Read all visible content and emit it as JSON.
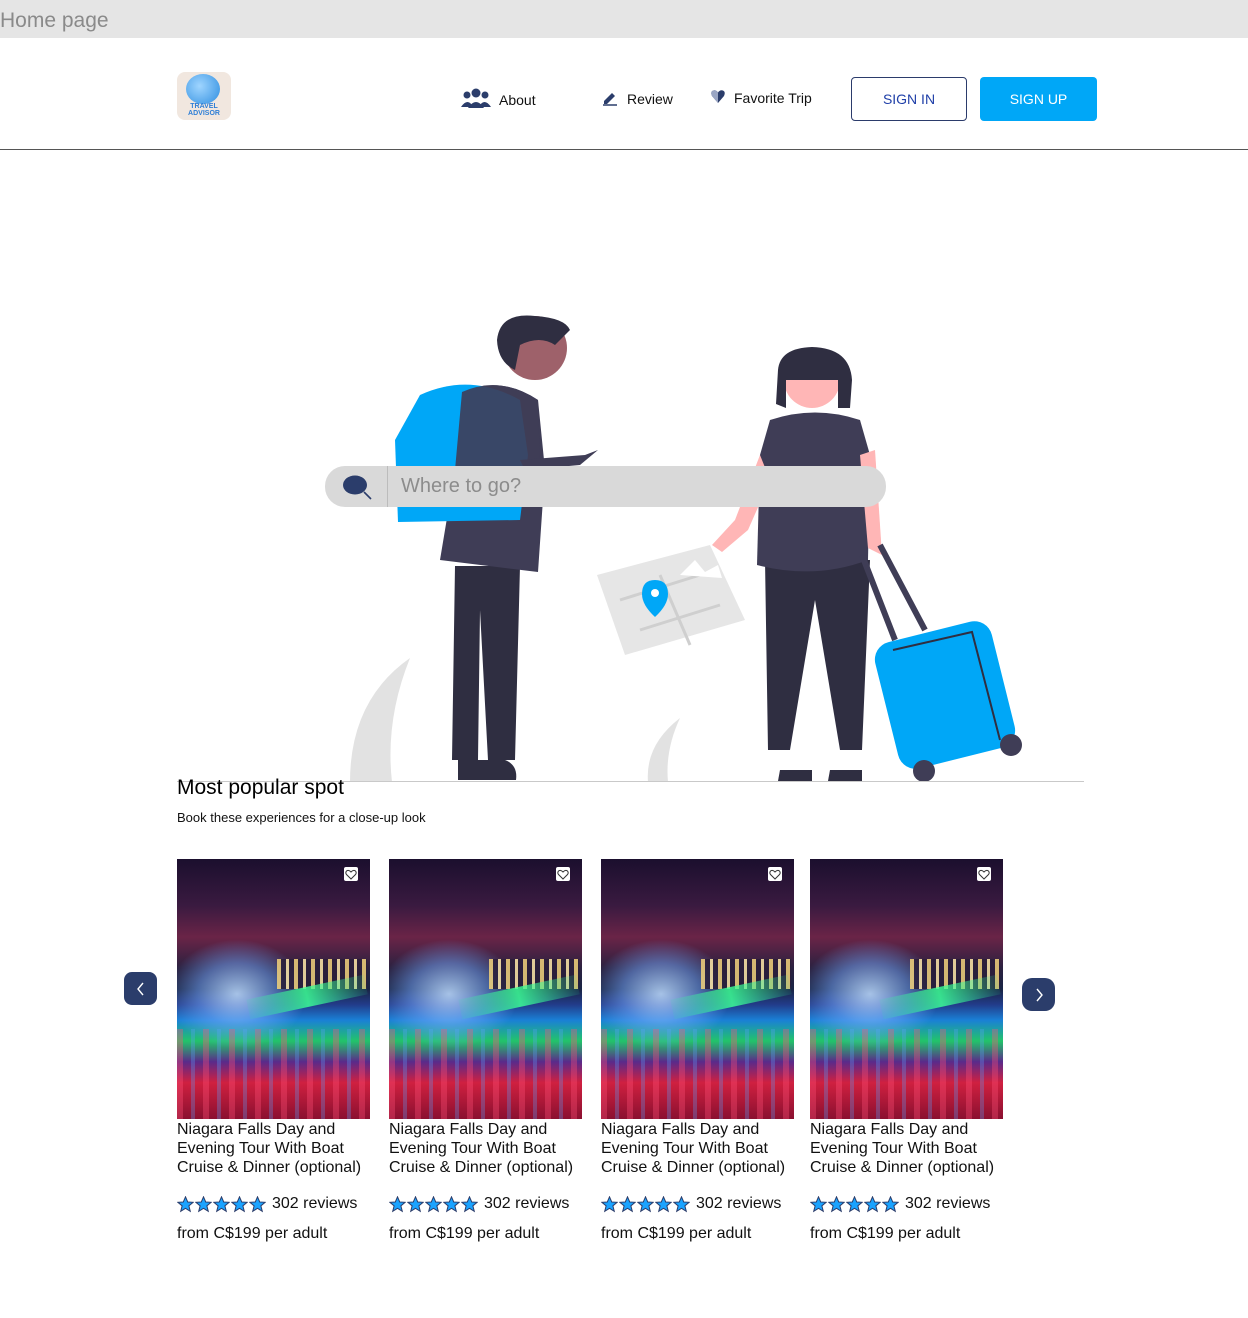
{
  "frame": {
    "label": "Home page"
  },
  "header": {
    "logo_text_line1": "TRAVEL",
    "logo_text_line2": "ADVISOR",
    "nav": [
      {
        "label": "About",
        "icon": "users-icon"
      },
      {
        "label": "Review",
        "icon": "pencil-icon"
      },
      {
        "label": "Favorite Trip",
        "icon": "heart-icon"
      }
    ],
    "signin_label": "SIGN IN",
    "signup_label": "SIGN UP"
  },
  "hero": {
    "search_placeholder": "Where to go?"
  },
  "popular": {
    "title": "Most popular spot",
    "subtitle": "Book these experiences for a close-up look",
    "cards": [
      {
        "title": "Niagara Falls Day and Evening Tour With Boat Cruise & Dinner (optional)",
        "rating": 5,
        "reviews": "302 reviews",
        "price": "from C$199 per adult"
      },
      {
        "title": "Niagara Falls Day and Evening Tour With Boat Cruise & Dinner (optional)",
        "rating": 5,
        "reviews": "302 reviews",
        "price": "from C$199 per adult"
      },
      {
        "title": "Niagara Falls Day and Evening Tour With Boat Cruise & Dinner (optional)",
        "rating": 5,
        "reviews": "302 reviews",
        "price": "from C$199 per adult"
      },
      {
        "title": "Niagara Falls Day and Evening Tour With Boat Cruise & Dinner (optional)",
        "rating": 5,
        "reviews": "302 reviews",
        "price": "from C$199 per adult"
      }
    ]
  },
  "colors": {
    "accent": "#00a7f7",
    "navy": "#2b3d6b",
    "star": "#1aa3ff"
  }
}
